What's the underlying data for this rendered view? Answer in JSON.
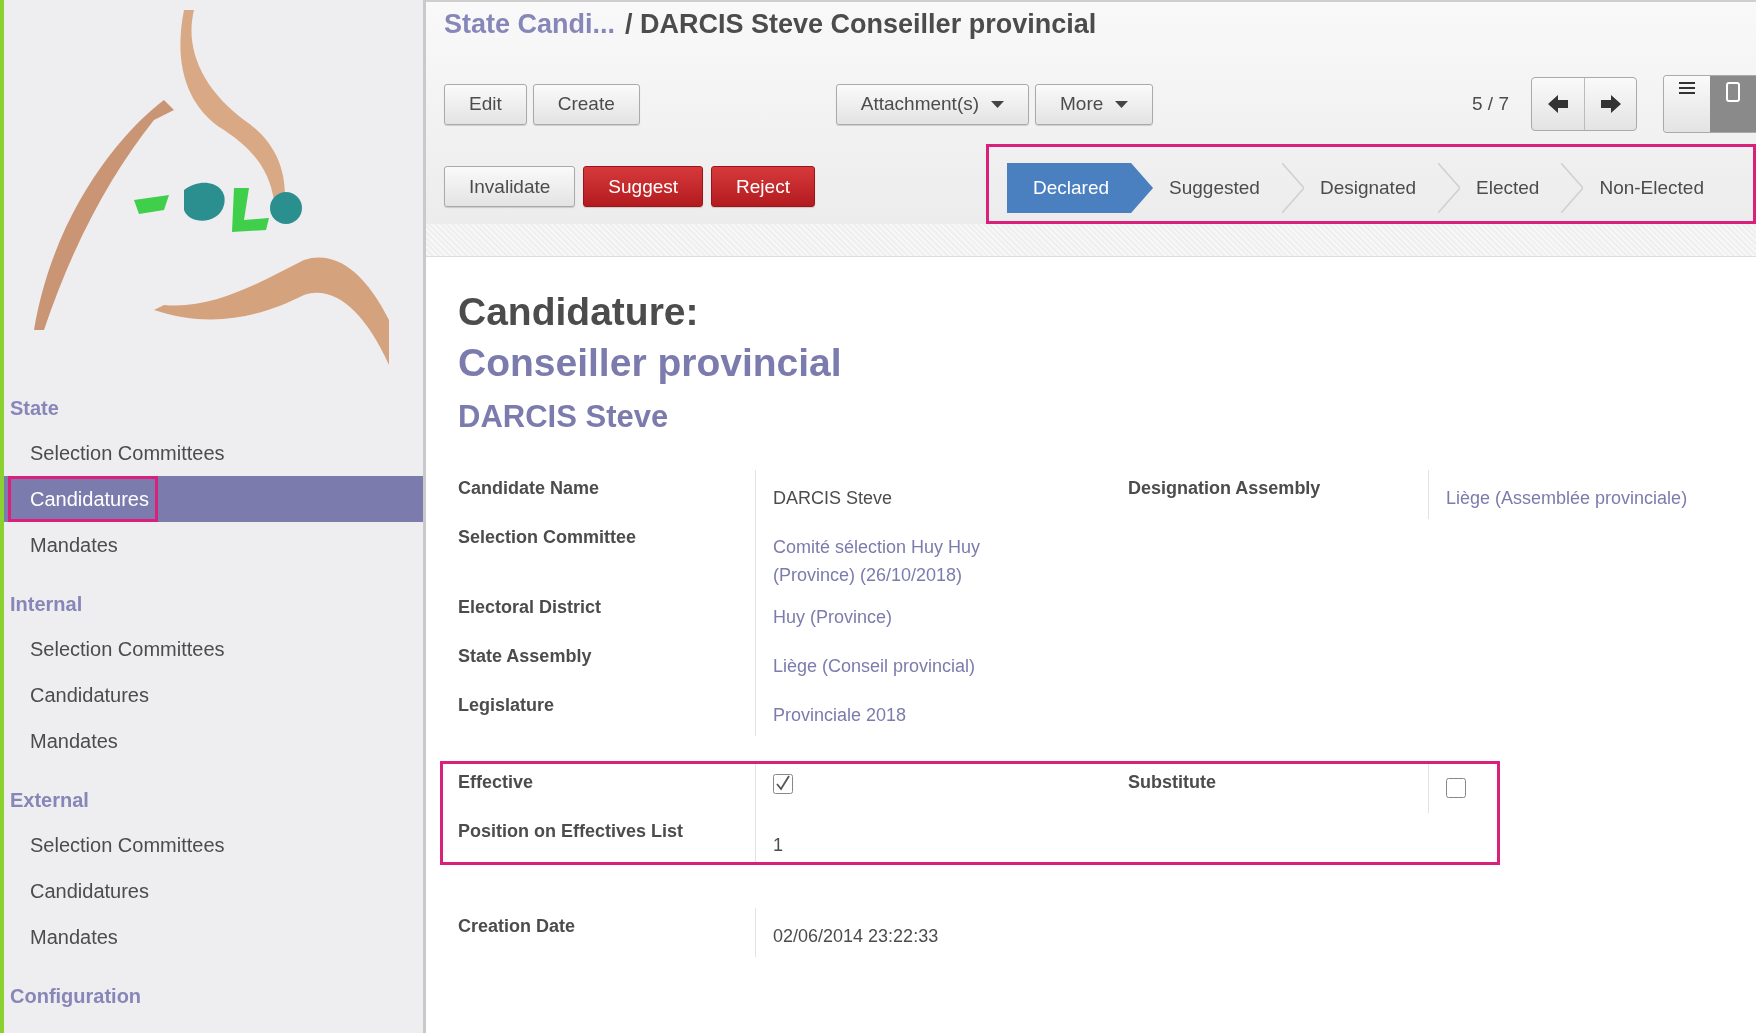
{
  "sidebar": {
    "sections": [
      {
        "title": "State",
        "items": [
          {
            "label": "Selection Committees",
            "selected": false,
            "highlighted": false
          },
          {
            "label": "Candidatures",
            "selected": true,
            "highlighted": true
          },
          {
            "label": "Mandates",
            "selected": false,
            "highlighted": false
          }
        ]
      },
      {
        "title": "Internal",
        "items": [
          {
            "label": "Selection Committees",
            "selected": false,
            "highlighted": false
          },
          {
            "label": "Candidatures",
            "selected": false,
            "highlighted": false
          },
          {
            "label": "Mandates",
            "selected": false,
            "highlighted": false
          }
        ]
      },
      {
        "title": "External",
        "items": [
          {
            "label": "Selection Committees",
            "selected": false,
            "highlighted": false
          },
          {
            "label": "Candidatures",
            "selected": false,
            "highlighted": false
          },
          {
            "label": "Mandates",
            "selected": false,
            "highlighted": false
          }
        ]
      },
      {
        "title": "Configuration"
      }
    ]
  },
  "breadcrumb": {
    "parent": "State Candi...",
    "separator": "/",
    "current": "DARCIS Steve Conseiller provincial"
  },
  "toolbar": {
    "buttons": [
      "Edit",
      "Create"
    ],
    "dropdowns": [
      "Attachment(s)",
      "More"
    ],
    "pager": "5 / 7",
    "views": [
      {
        "kind": "list",
        "selected": false
      },
      {
        "kind": "form",
        "selected": true
      }
    ]
  },
  "actions": [
    {
      "label": "Invalidate",
      "kind": "default"
    },
    {
      "label": "Suggest",
      "kind": "danger"
    },
    {
      "label": "Reject",
      "kind": "danger"
    }
  ],
  "statusbar": {
    "highlighted": true,
    "steps": [
      {
        "label": "Declared",
        "selected": true
      },
      {
        "label": "Suggested",
        "selected": false
      },
      {
        "label": "Designated",
        "selected": false
      },
      {
        "label": "Elected",
        "selected": false
      },
      {
        "label": "Non-Elected",
        "selected": false
      }
    ]
  },
  "form": {
    "heading": "Candidature:",
    "title": "Conseiller provincial",
    "subtitle": "DARCIS Steve",
    "groups": [
      {
        "highlighted": false,
        "left": [
          {
            "label": "Candidate Name",
            "kind": "text",
            "value": "DARCIS Steve"
          },
          {
            "label": "Selection Committee",
            "kind": "link",
            "value": "Comité sélection Huy Huy (Province) (26/10/2018)"
          },
          {
            "label": "Electoral District",
            "kind": "link",
            "value": "Huy (Province)"
          },
          {
            "label": "State Assembly",
            "kind": "link",
            "value": "Liège (Conseil provincial)"
          },
          {
            "label": "Legislature",
            "kind": "link",
            "value": "Provinciale 2018"
          }
        ],
        "right": [
          {
            "label": "Designation Assembly",
            "kind": "link",
            "value": "Liège (Assemblée provinciale)"
          }
        ]
      },
      {
        "highlighted": true,
        "left": [
          {
            "label": "Effective",
            "kind": "checkbox",
            "checked": true
          },
          {
            "label": "Position on Effectives List",
            "kind": "text",
            "value": "1"
          }
        ],
        "right": [
          {
            "label": "Substitute",
            "kind": "checkbox",
            "checked": false
          }
        ]
      },
      {
        "highlighted": false,
        "left": [
          {
            "label": "Creation Date",
            "kind": "text",
            "value": "02/06/2014 23:22:33"
          }
        ]
      }
    ]
  }
}
